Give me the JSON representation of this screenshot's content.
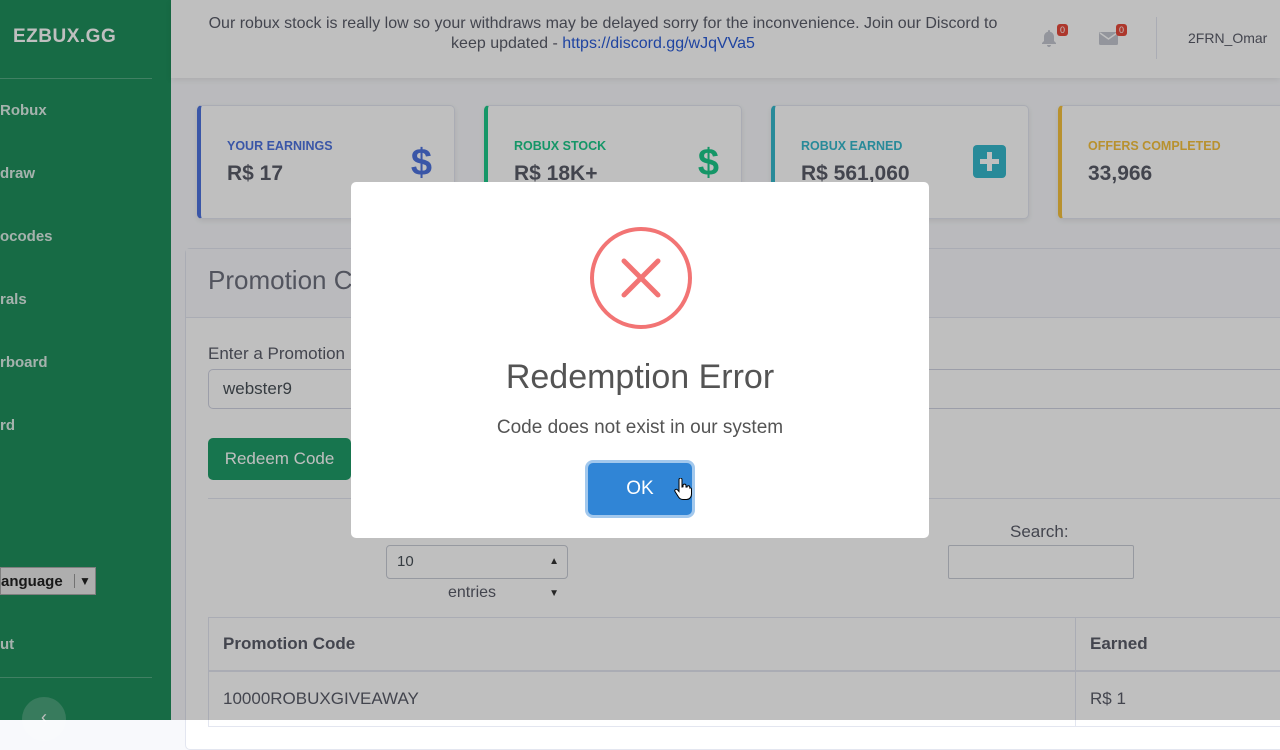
{
  "sidebar": {
    "brand": "EZBUX.GG",
    "items": [
      {
        "label": "Robux"
      },
      {
        "label": "draw"
      },
      {
        "label": "ocodes"
      },
      {
        "label": "rals"
      },
      {
        "label": "rboard"
      },
      {
        "label": "rd"
      }
    ],
    "language_label": "anguage",
    "logout_label": "ut"
  },
  "topbar": {
    "notice_text": "Our robux stock is really low so your withdraws may be delayed sorry for the inconvenience. Join our Discord to keep updated - ",
    "notice_link": "https://discord.gg/wJqVVa5",
    "notifications_count": "0",
    "messages_count": "0",
    "username": "2FRN_Omar"
  },
  "cards": [
    {
      "title": "YOUR EARNINGS",
      "value": "R$ 17",
      "icon": "dollar-icon",
      "color": "#4e73df"
    },
    {
      "title": "ROBUX STOCK",
      "value": "R$ 18K+",
      "icon": "dollar-icon",
      "color": "#1cc88a"
    },
    {
      "title": "ROBUX EARNED",
      "value": "R$ 561,060",
      "icon": "plus-square-icon",
      "color": "#36b9cc"
    },
    {
      "title": "OFFERS COMPLETED",
      "value": "33,966",
      "icon": "users-icon",
      "color": "#f6c23e"
    }
  ],
  "main": {
    "title": "Promotion C",
    "promo_label": "Enter a Promotion",
    "promo_value": "webster9",
    "redeem_label": "Redeem Code",
    "entries_value": "10",
    "entries_label": "entries",
    "search_label": "Search:",
    "table": {
      "headers": [
        "Promotion Code",
        "Earned"
      ],
      "rows": [
        [
          "10000ROBUXGIVEAWAY",
          "R$ 1"
        ]
      ]
    }
  },
  "modal": {
    "title": "Redemption Error",
    "message": "Code does not exist in our system",
    "ok_label": "OK"
  }
}
